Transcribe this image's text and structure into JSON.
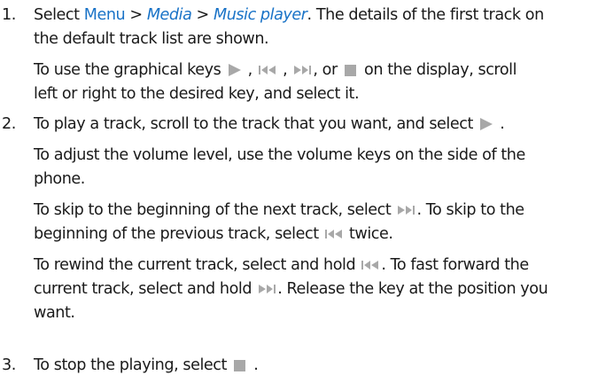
{
  "steps": [
    {
      "number": "1.",
      "line1": {
        "before": "Select ",
        "menu": "Menu",
        "sep1": " > ",
        "media": "Media",
        "sep2": " > ",
        "music_player": "Music player",
        "after": ". The details of the first track on"
      },
      "line2": "the default track list are shown.",
      "para2": {
        "before": "To use the graphical keys ",
        "comma1": " , ",
        "comma2": " , ",
        "or": ", or ",
        "after": " on the display, scroll",
        "line2": "left or right to the desired key, and select it."
      }
    },
    {
      "number": "2.",
      "para1": {
        "before": "To play a track, scroll to the track that you want, and select ",
        "after": " ."
      },
      "para2": {
        "line1": "To adjust the volume level, use the volume keys on the side of the",
        "line2": "phone."
      },
      "para3": {
        "before": "To skip to the beginning of the next track, select ",
        "after": ". To skip to the",
        "line2_before": "beginning of the previous track, select ",
        "line2_after": " twice."
      },
      "para4": {
        "before": "To rewind the current track, select and hold ",
        "after": ". To fast forward the",
        "line2_before": "current track, select and hold ",
        "line2_after": ". Release the key at the position you",
        "line3": "want."
      }
    },
    {
      "number": "3.",
      "para1": {
        "before": "To stop the playing, select ",
        "after": " ."
      }
    }
  ],
  "icons": {
    "play": "play-icon",
    "previous": "previous-track-icon",
    "next": "next-track-icon",
    "stop": "stop-icon"
  },
  "colors": {
    "link": "#1a73c7",
    "text": "#1a1a1a",
    "icon": "#a8a8a8"
  }
}
